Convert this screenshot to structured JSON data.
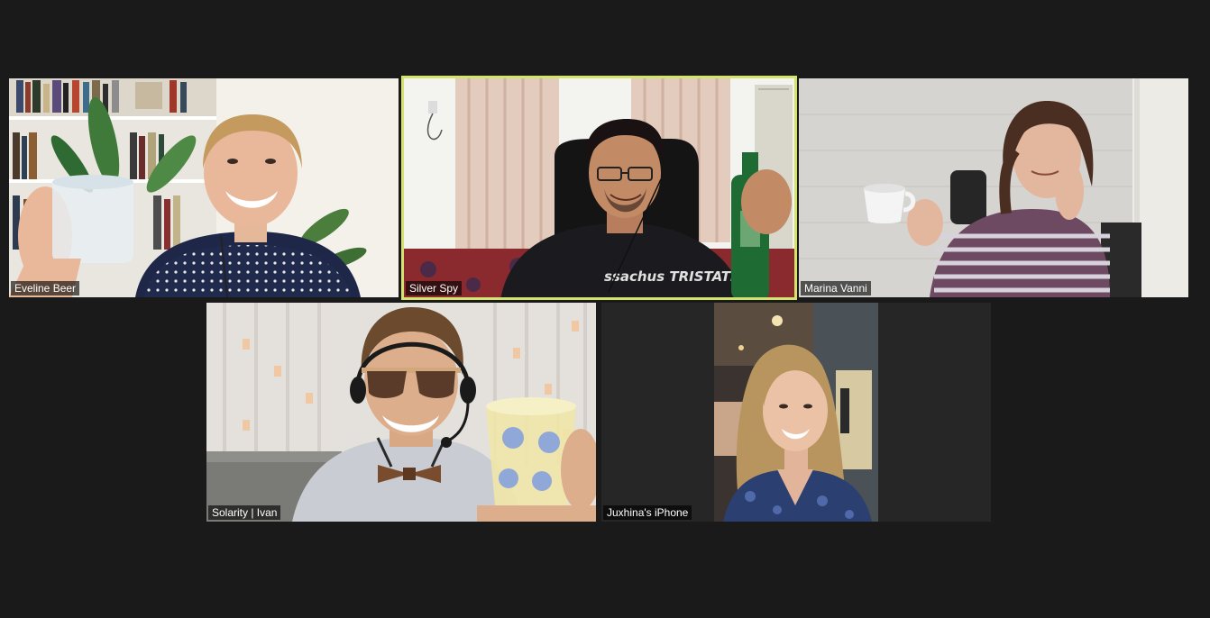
{
  "gallery": {
    "participants": [
      {
        "name": "Eveline Beer"
      },
      {
        "name": "Silver Spy",
        "active_speaker": true
      },
      {
        "name": "Marina Vanni"
      },
      {
        "name": "Solarity | Ivan"
      },
      {
        "name": "Juxhina's iPhone"
      }
    ]
  },
  "colors": {
    "background": "#1a1a1a",
    "tile_background": "#262626",
    "active_speaker_border": "#d4e36e",
    "name_tag_text": "#ffffff"
  },
  "video_content": {
    "silver_spy_shirt_text": "ssachus TRISTATE"
  }
}
